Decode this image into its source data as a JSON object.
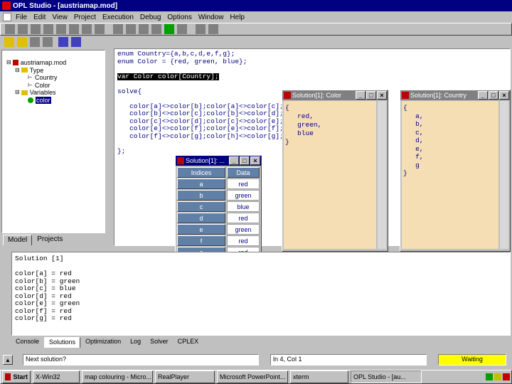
{
  "app": {
    "title": "OPL Studio - [austriamap.mod]",
    "title_controls": [
      "_",
      "□",
      "×"
    ]
  },
  "menu": [
    "File",
    "Edit",
    "View",
    "Project",
    "Execution",
    "Debug",
    "Options",
    "Window",
    "Help"
  ],
  "tree": {
    "items": [
      {
        "label": "austriamap.mod",
        "level": 0
      },
      {
        "label": "Type",
        "level": 1
      },
      {
        "label": "Country",
        "level": 2
      },
      {
        "label": "Color",
        "level": 2
      },
      {
        "label": "Variables",
        "level": 1
      },
      {
        "label": "color",
        "level": 2,
        "selected": true
      }
    ],
    "tabs": [
      "Model",
      "Projects"
    ]
  },
  "editor": {
    "lines": [
      "enum Country={a,b,c,d,e,f,g};",
      "enum Color = {red, green, blue};",
      "",
      "var Color color[Country];",
      "",
      "solve{",
      "",
      "   color[a]<>color[b];color[a]<>color[c];",
      "   color[b]<>color[c];color[b]<>color[d];",
      "   color[c]<>color[d];color[c]<>color[e];",
      "   color[e]<>color[f];color[e]<>color[f];",
      "   color[f]<>color[g];color[h]<>color[g];",
      "",
      "};"
    ],
    "highlighted_line": 3
  },
  "win_color": {
    "title": "Solution[1]: Color",
    "lines": [
      "{",
      "   red,",
      "   green,",
      "   blue",
      "}"
    ]
  },
  "win_country": {
    "title": "Solution[1]: Country",
    "lines": [
      "{",
      "   a,",
      "   b,",
      "   c,",
      "   d,",
      "   e,",
      "   f,",
      "   g",
      "}"
    ]
  },
  "win_table": {
    "title": "Solution[1]: ...",
    "headers": [
      "Indices",
      "Data"
    ],
    "rows": [
      [
        "a",
        "red"
      ],
      [
        "b",
        "green"
      ],
      [
        "c",
        "blue"
      ],
      [
        "d",
        "red"
      ],
      [
        "e",
        "green"
      ],
      [
        "f",
        "red"
      ],
      [
        "g",
        "red"
      ]
    ]
  },
  "output": {
    "lines": [
      "Solution [1]",
      "",
      "color[a] = red",
      "color[b] = green",
      "color[c] = blue",
      "color[d] = red",
      "color[e] = green",
      "color[f] = red",
      "color[g] = red"
    ],
    "tabs": [
      "Console",
      "Solutions",
      "Optimization",
      "Log",
      "Solver",
      "CPLEX"
    ],
    "active_tab": 1
  },
  "statusbar": {
    "message": "Next solution?",
    "position": "ln 4, Col 1",
    "state": "Waiting"
  },
  "taskbar": {
    "start": "Start",
    "items": [
      "X-Win32",
      "map colouring - Micro...",
      "RealPlayer",
      "Microsoft PowerPoint...",
      "xterm",
      "OPL Studio - [au..."
    ]
  },
  "colors": {
    "titlebar": "#000080",
    "editor_text": "#000080",
    "solution_bg": "#f5deb3",
    "status_waiting": "#ffff00"
  }
}
